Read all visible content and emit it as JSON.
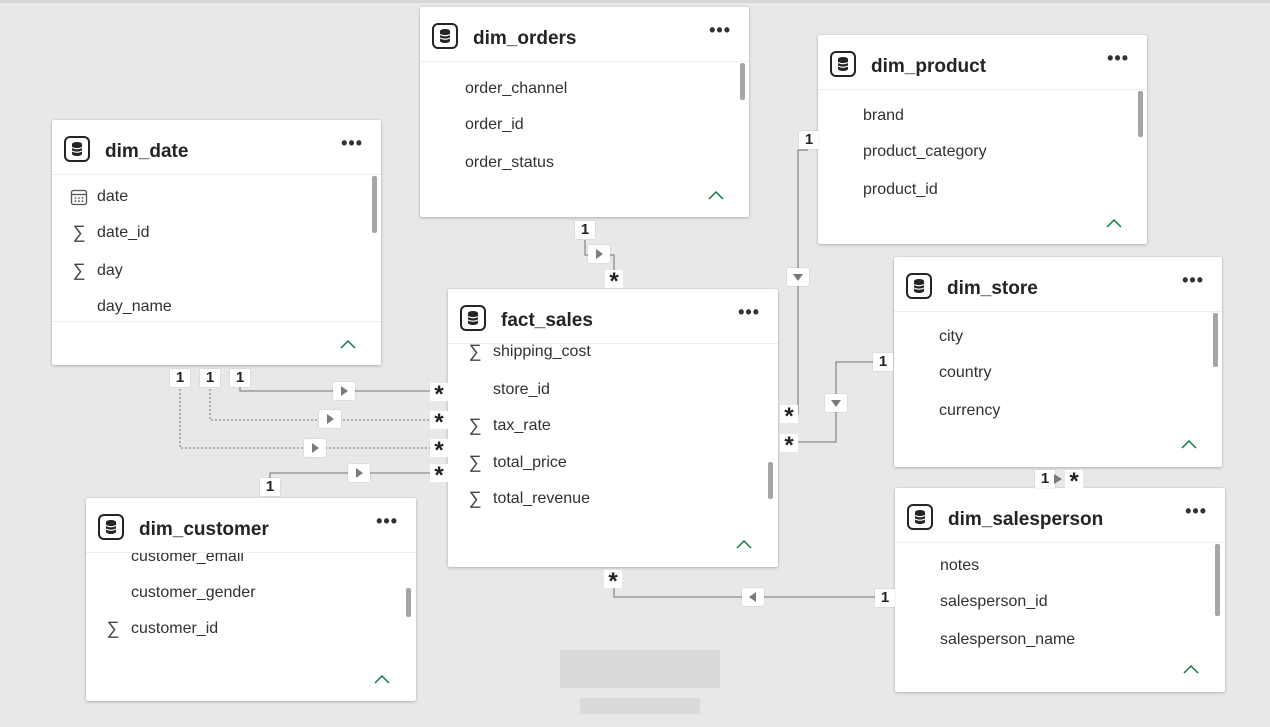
{
  "tables": {
    "dim_orders": {
      "name": "dim_orders",
      "fields": [
        {
          "label": "order_channel",
          "icon": ""
        },
        {
          "label": "order_id",
          "icon": ""
        },
        {
          "label": "order_status",
          "icon": ""
        }
      ]
    },
    "dim_product": {
      "name": "dim_product",
      "fields": [
        {
          "label": "brand",
          "icon": ""
        },
        {
          "label": "product_category",
          "icon": ""
        },
        {
          "label": "product_id",
          "icon": ""
        }
      ]
    },
    "dim_date": {
      "name": "dim_date",
      "fields": [
        {
          "label": "date",
          "icon": "calendar"
        },
        {
          "label": "date_id",
          "icon": "sigma"
        },
        {
          "label": "day",
          "icon": "sigma"
        },
        {
          "label": "day_name",
          "icon": ""
        }
      ]
    },
    "fact_sales": {
      "name": "fact_sales",
      "fields": [
        {
          "label": "shipping_cost",
          "icon": "sigma"
        },
        {
          "label": "store_id",
          "icon": ""
        },
        {
          "label": "tax_rate",
          "icon": "sigma"
        },
        {
          "label": "total_price",
          "icon": "sigma"
        },
        {
          "label": "total_revenue",
          "icon": "sigma"
        }
      ]
    },
    "dim_store": {
      "name": "dim_store",
      "fields": [
        {
          "label": "city",
          "icon": ""
        },
        {
          "label": "country",
          "icon": ""
        },
        {
          "label": "currency",
          "icon": ""
        }
      ]
    },
    "dim_customer": {
      "name": "dim_customer",
      "fields": [
        {
          "label": "customer_email",
          "icon": ""
        },
        {
          "label": "customer_gender",
          "icon": ""
        },
        {
          "label": "customer_id",
          "icon": "sigma"
        }
      ]
    },
    "dim_salesperson": {
      "name": "dim_salesperson",
      "fields": [
        {
          "label": "notes",
          "icon": ""
        },
        {
          "label": "salesperson_id",
          "icon": ""
        },
        {
          "label": "salesperson_name",
          "icon": ""
        }
      ]
    }
  },
  "cardinality": {
    "one": "1",
    "many": "*"
  },
  "more_glyph": "•••",
  "colors": {
    "accent": "#107c41",
    "line": "#777777",
    "canvas": "#e8e8e7"
  }
}
